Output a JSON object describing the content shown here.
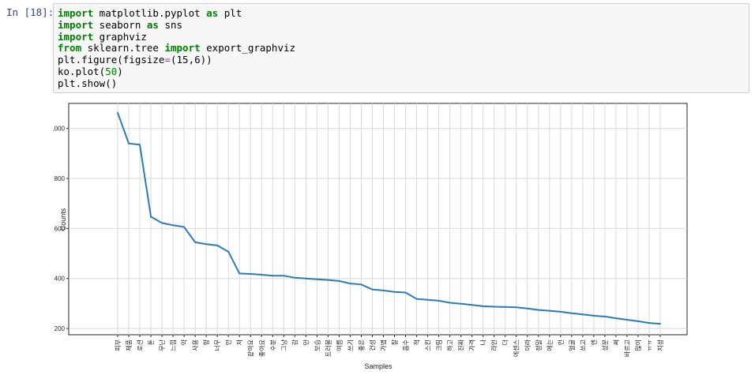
{
  "cell": {
    "prompt": "In [18]:",
    "code_lines": [
      [
        {
          "t": "import",
          "c": "kw"
        },
        {
          "t": " matplotlib.pyplot "
        },
        {
          "t": "as",
          "c": "kw"
        },
        {
          "t": " plt"
        }
      ],
      [
        {
          "t": "import",
          "c": "kw"
        },
        {
          "t": " seaborn "
        },
        {
          "t": "as",
          "c": "kw"
        },
        {
          "t": " sns"
        }
      ],
      [
        {
          "t": "import",
          "c": "kw"
        },
        {
          "t": " graphviz"
        }
      ],
      [
        {
          "t": "from",
          "c": "kw"
        },
        {
          "t": " sklearn.tree "
        },
        {
          "t": "import",
          "c": "kw"
        },
        {
          "t": " export_graphviz"
        }
      ],
      [
        {
          "t": "plt.figure(figsize"
        },
        {
          "t": "=",
          "c": "op"
        },
        {
          "t": "(15,6))"
        }
      ],
      [
        {
          "t": "ko.plot("
        },
        {
          "t": "50",
          "c": "num"
        },
        {
          "t": ")"
        }
      ],
      [
        {
          "t": "plt.show()"
        }
      ]
    ]
  },
  "chart_data": {
    "type": "line",
    "xlabel": "Samples",
    "ylabel": "Counts",
    "ylim": [
      175,
      1100
    ],
    "yticks": [
      200,
      400,
      600,
      800,
      1000
    ],
    "grid": true,
    "line_color": "#2c7bb6",
    "categories": [
      "피부",
      "제품",
      "로션",
      "톤",
      "무난",
      "느낌",
      "약",
      "사용",
      "향",
      "너무",
      "안",
      "저",
      "같아요",
      "좋아요",
      "수분",
      "그냥",
      "감",
      "만",
      "보습",
      "트러블",
      "여름",
      "쓰기",
      "좋은",
      "건성",
      "가볍",
      "잘",
      "흡수",
      "적",
      "스킨",
      "크림",
      "하고",
      "진짜",
      "가격",
      "나",
      "라인",
      "더",
      "에센스",
      "이라",
      "정말",
      "에는",
      "인",
      "얼굴",
      "쓰고",
      "엔",
      "성분",
      "써",
      "바르고",
      "많이",
      "ㅠㅠ",
      "지성"
    ],
    "values": [
      1063,
      940,
      935,
      647,
      622,
      613,
      606,
      545,
      537,
      532,
      507,
      420,
      418,
      415,
      411,
      411,
      403,
      400,
      397,
      394,
      390,
      380,
      376,
      356,
      352,
      346,
      344,
      318,
      315,
      311,
      303,
      299,
      294,
      289,
      287,
      286,
      285,
      280,
      274,
      271,
      267,
      261,
      256,
      251,
      248,
      241,
      235,
      229,
      222,
      219
    ]
  }
}
